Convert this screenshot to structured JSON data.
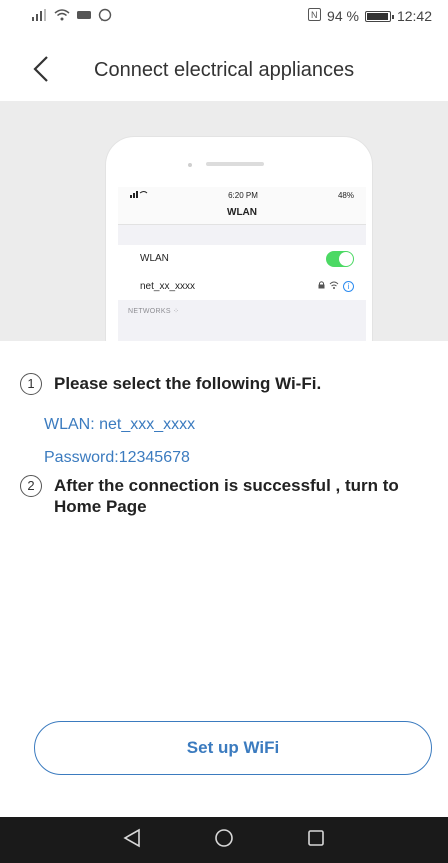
{
  "status_bar": {
    "signal_icon": "signal-icon",
    "wifi_icon": "wifi-icon",
    "battery_percent": "94 %",
    "battery_level": 0.94,
    "time": "12:42"
  },
  "header": {
    "title": "Connect electrical appliances",
    "back_icon": "chevron-left-icon"
  },
  "illustration": {
    "status_time": "6:20 PM",
    "status_battery": "48%",
    "title": "WLAN",
    "wlan_label": "WLAN",
    "wlan_on": true,
    "network_name": "net_xx_xxxx",
    "networks_label": "NETWORKS"
  },
  "steps": [
    {
      "number": "1",
      "text": "Please select the following Wi-Fi."
    },
    {
      "number": "2",
      "text": "After the connection is successful , turn to Home Page"
    }
  ],
  "wifi_info": {
    "wlan": "WLAN: net_xxx_xxxx",
    "password": "Password:12345678"
  },
  "setup_button": {
    "label": "Set up WiFi"
  },
  "nav_bar": {
    "back_icon": "triangle-back-icon",
    "home_icon": "circle-home-icon",
    "recent_icon": "square-recent-icon"
  },
  "colors": {
    "accent": "#3b7bbf",
    "toggle_on": "#4cd964",
    "nav_background": "#1a1a1a",
    "hero_background": "#ececec"
  }
}
